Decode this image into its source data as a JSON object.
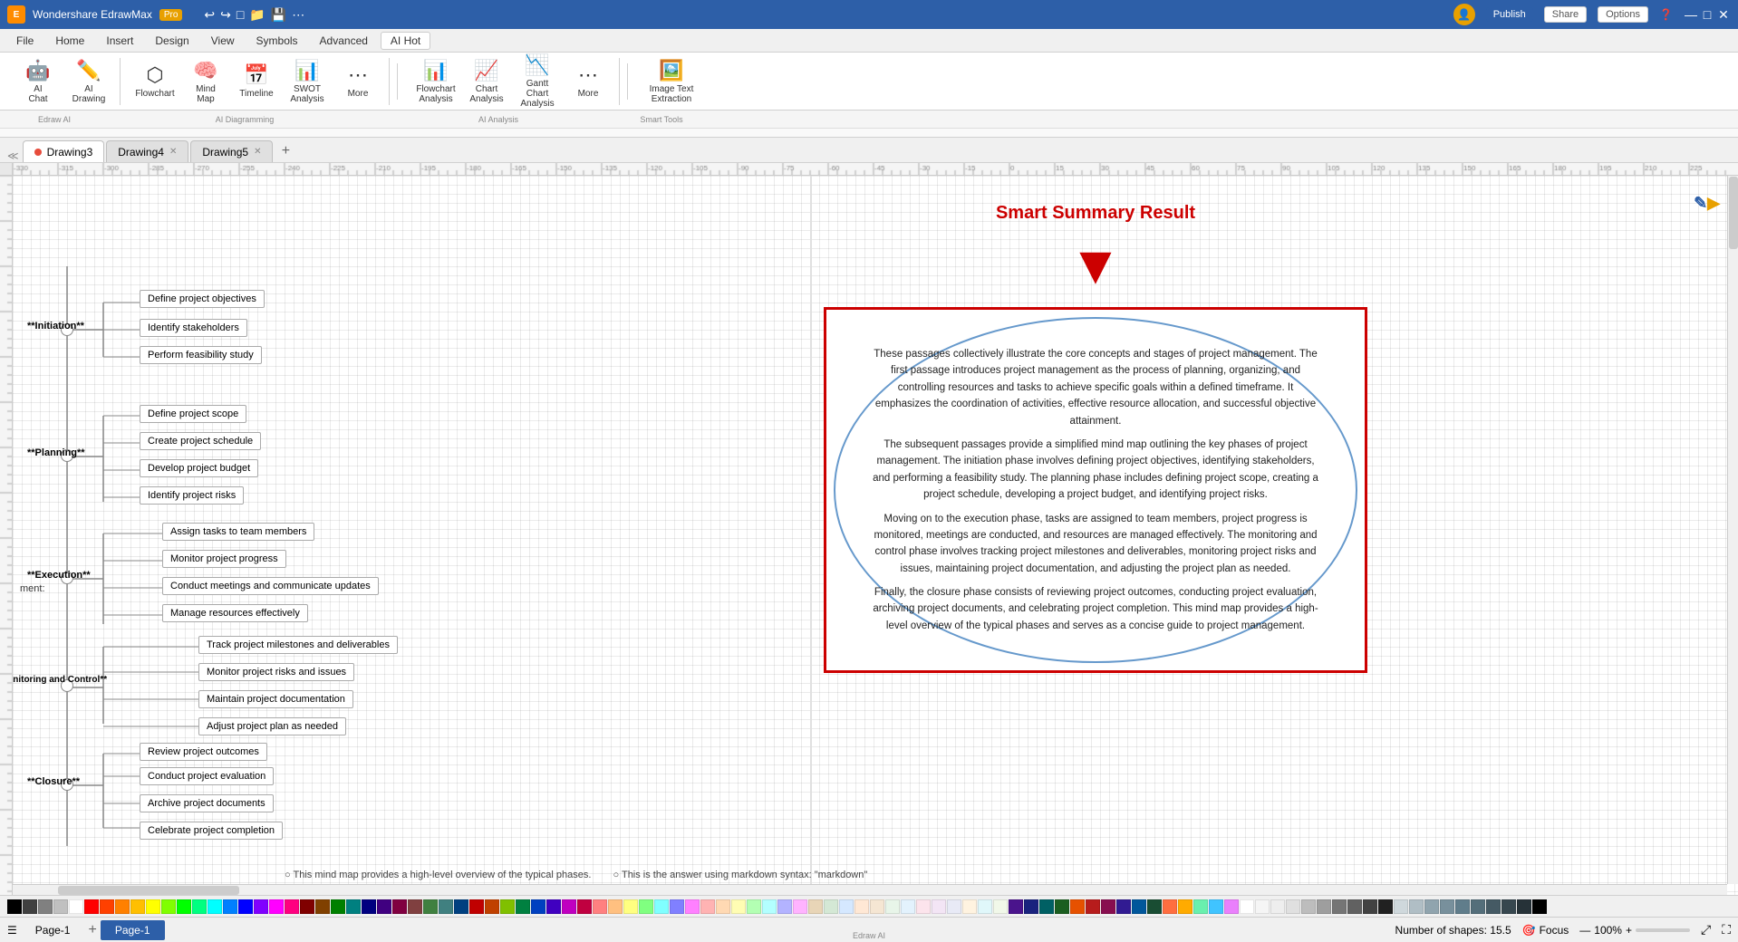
{
  "titlebar": {
    "app_name": "Wondershare EdrawMax - Pro",
    "file_name": "",
    "undo_label": "Undo",
    "redo_label": "Redo",
    "controls": [
      "—",
      "□",
      "✕"
    ]
  },
  "menu": {
    "items": [
      "File",
      "Home",
      "Insert",
      "Design",
      "View",
      "Symbols",
      "Advanced",
      "AI"
    ]
  },
  "ribbon": {
    "ai_badge": "Hot",
    "groups": [
      {
        "label": "Edraw AI",
        "buttons": [
          {
            "icon": "🤖",
            "label": "AI Chat"
          },
          {
            "icon": "✏️",
            "label": "AI Drawing"
          }
        ]
      },
      {
        "label": "AI Diagramming",
        "buttons": [
          {
            "icon": "⬡",
            "label": "Flowchart"
          },
          {
            "icon": "🧠",
            "label": "Mind Map"
          },
          {
            "icon": "📅",
            "label": "Timeline"
          },
          {
            "icon": "📊",
            "label": "SWOT Analysis"
          },
          {
            "icon": "⋯",
            "label": "More"
          },
          {
            "icon": "📊",
            "label": "Flowchart Analysis"
          },
          {
            "icon": "📈",
            "label": "Chart Analysis"
          },
          {
            "icon": "📉",
            "label": "Gantt Chart Analysis"
          },
          {
            "icon": "⋯",
            "label": "More"
          }
        ]
      },
      {
        "label": "AI Analysis",
        "buttons": []
      },
      {
        "label": "Smart Tools",
        "buttons": [
          {
            "icon": "🖼️",
            "label": "Image Text Extraction"
          }
        ]
      }
    ]
  },
  "doc_tabs": [
    {
      "label": "Drawing3",
      "active": true,
      "has_dot": true
    },
    {
      "label": "Drawing4",
      "active": false
    },
    {
      "label": "Drawing5",
      "active": false
    }
  ],
  "mindmap": {
    "center": "ment:",
    "phases": [
      {
        "label": "**Initiation**",
        "nodes": [
          "Define project objectives",
          "Identify stakeholders",
          "Perform feasibility study"
        ]
      },
      {
        "label": "**Planning**",
        "nodes": [
          "Define project scope",
          "Create project schedule",
          "Develop project budget",
          "Identify project risks"
        ]
      },
      {
        "label": "**Execution**",
        "nodes": [
          "Assign tasks to team members",
          "Monitor project progress",
          "Conduct meetings and communicate updates",
          "Manage resources effectively"
        ]
      },
      {
        "label": "**Monitoring and Control**",
        "nodes": [
          "Track project milestones and deliverables",
          "Monitor project risks and issues",
          "Maintain project documentation",
          "Adjust project plan as needed"
        ]
      },
      {
        "label": "**Closure**",
        "nodes": [
          "Review project outcomes",
          "Conduct project evaluation",
          "Archive project documents",
          "Celebrate project completion"
        ]
      }
    ]
  },
  "smart_summary": {
    "title": "Smart Summary Result",
    "body_paragraphs": [
      "These passages collectively illustrate the core concepts and stages of project management. The first passage introduces project management as the process of planning, organizing, and controlling resources and tasks to achieve specific goals within a defined timeframe. It emphasizes the coordination of activities, effective resource allocation, and successful objective attainment.",
      "The subsequent passages provide a simplified mind map outlining the key phases of project management. The initiation phase involves defining project objectives, identifying stakeholders, and performing a feasibility study. The planning phase includes defining project scope, creating a project schedule, developing a project budget, and identifying project risks.",
      "Moving on to the execution phase, tasks are assigned to team members, project progress is monitored, meetings are conducted, and resources are managed effectively. The monitoring and control phase involves tracking project milestones and deliverables, monitoring project risks and issues, maintaining project documentation, and adjusting the project plan as needed.",
      "Finally, the closure phase consists of reviewing project outcomes, conducting project evaluation, archiving project documents, and celebrating project completion. This mind map provides a high-level overview of the typical phases and serves as a concise guide to project management."
    ]
  },
  "bottom_text": {
    "left": "This mind map provides a high-level overview of the typical phases.",
    "right": "This is the answer using markdown syntax: \"markdown\""
  },
  "statusbar": {
    "page_label": "Page-1",
    "shapes_label": "Number of shapes: 15.5",
    "focus_label": "Focus",
    "zoom_label": "100%"
  },
  "toolbar_right": {
    "publish_label": "Publish",
    "share_label": "Share",
    "options_label": "Options"
  },
  "colors": {
    "brand_blue": "#2d5fa8",
    "summary_red": "#cc0000",
    "oval_blue": "#6699cc"
  }
}
